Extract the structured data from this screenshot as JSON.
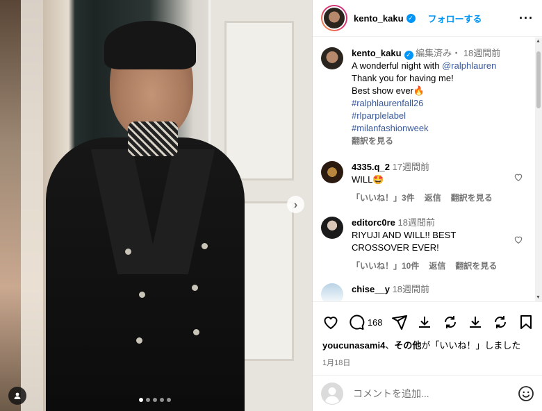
{
  "post": {
    "username": "kento_kaku",
    "follow_label": "フォローする",
    "edited_label": "編集済み・",
    "time_ago": "18週間前",
    "caption_lines": [
      "A wonderful night with ",
      "Thank you for having me!",
      "Best show ever🔥"
    ],
    "mention": "@ralphlauren",
    "hashtags": [
      "#ralphlaurenfall26",
      "#rlparplelabel",
      "#milanfashionweek"
    ],
    "translate_label": "翻訳を見る"
  },
  "comments": [
    {
      "username": "4335.q_2",
      "time": "17週間前",
      "text": "WILL🤩",
      "likes": "「いいね！」3件",
      "reply": "返信",
      "translate": "翻訳を見る"
    },
    {
      "username": "editorc0re",
      "time": "18週間前",
      "text": "RIYUJI AND WILL!! BEST CROSSOVER EVER!",
      "likes": "「いいね！」10件",
      "reply": "返信",
      "translate": "翻訳を見る"
    },
    {
      "username": "chise__y",
      "time": "18週間前"
    }
  ],
  "actions": {
    "comment_count": "168"
  },
  "likes_line": {
    "user": "youcunasami4",
    "middle": "、",
    "others": "その他",
    "suffix": "が「いいね！」しました"
  },
  "date": "1月18日",
  "add_comment": {
    "placeholder": "コメントを追加..."
  },
  "colors": {
    "link": "#385899",
    "follow": "#0095f6",
    "muted": "#737373"
  },
  "carousel": {
    "count": 5,
    "active": 0
  }
}
